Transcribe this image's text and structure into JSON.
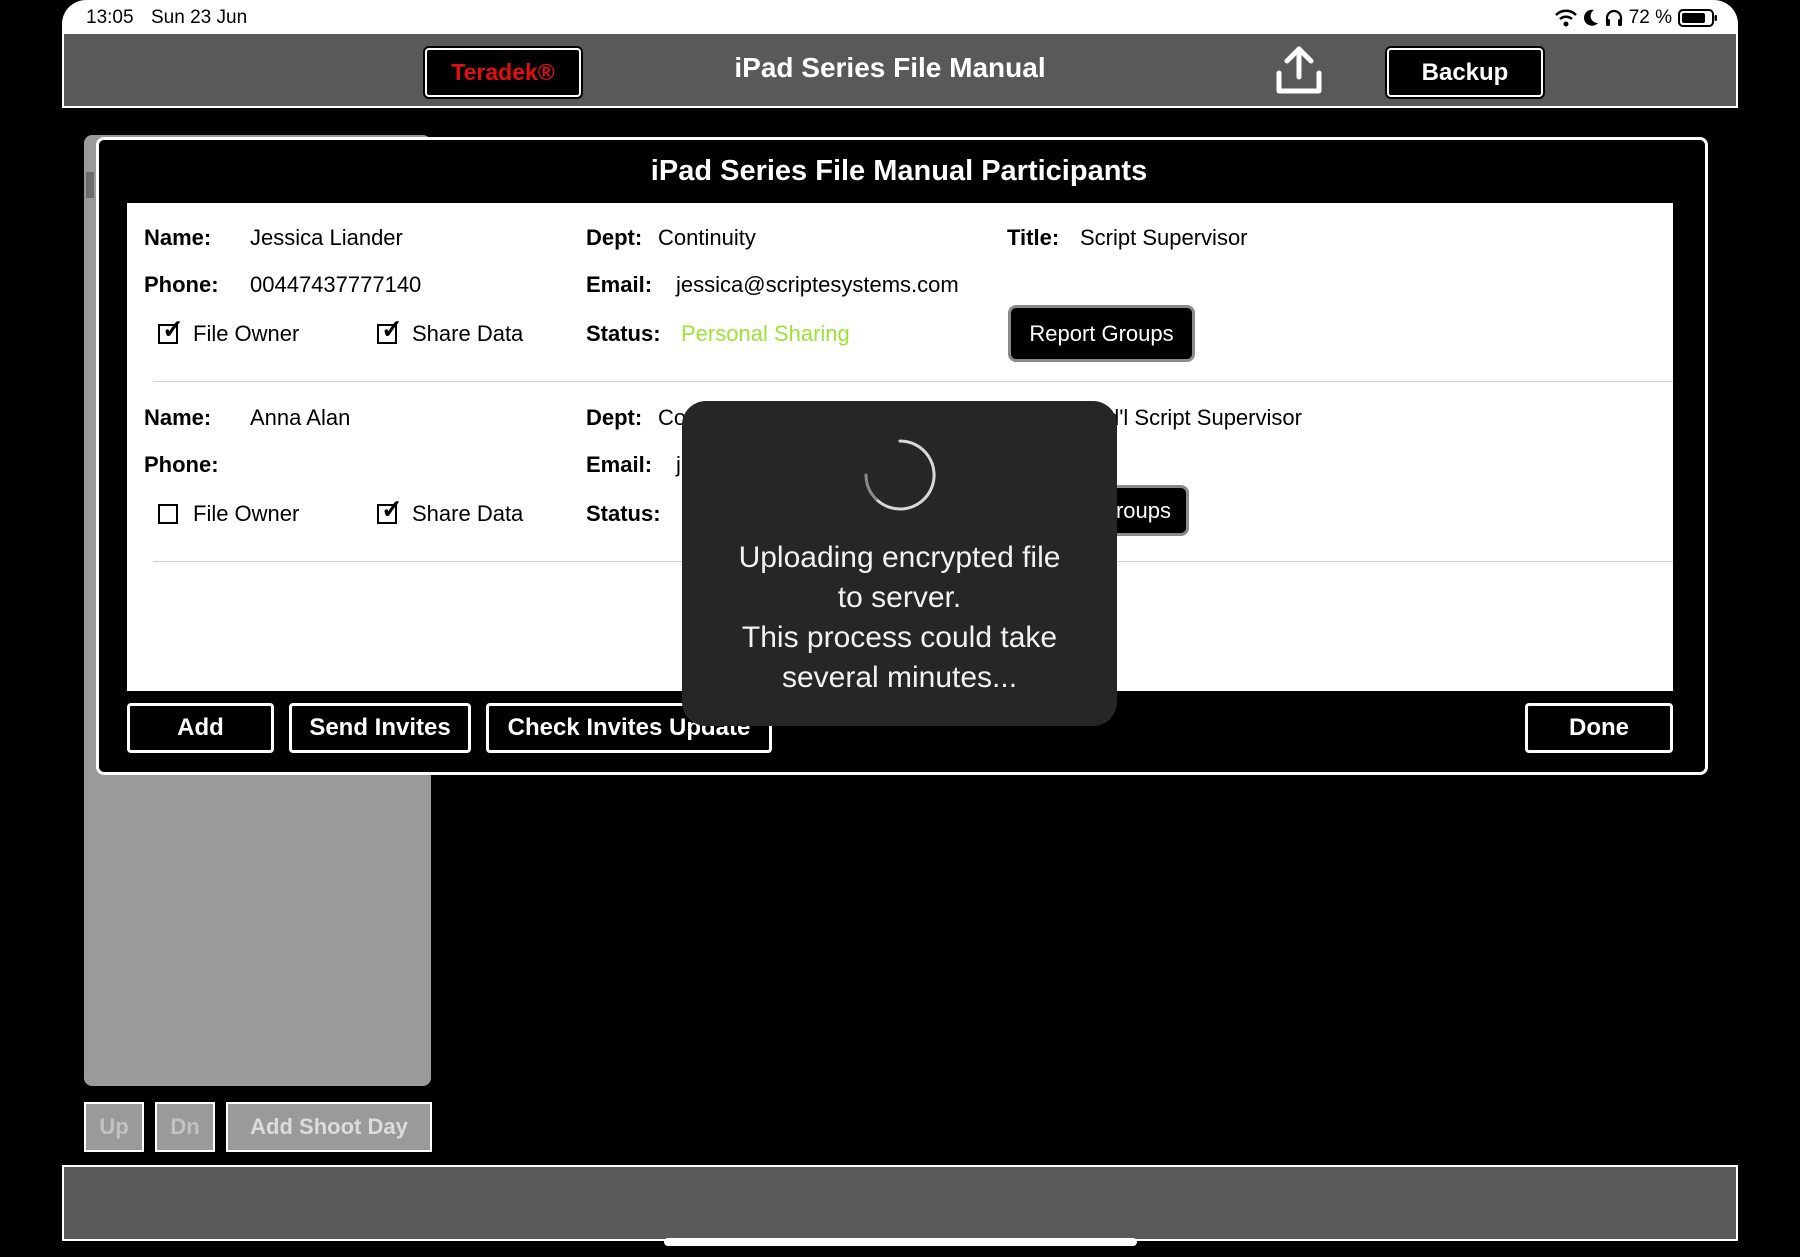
{
  "status_bar": {
    "time": "13:05",
    "date": "Sun 23 Jun",
    "battery": "72 %"
  },
  "header": {
    "brand_button": "Teradek®",
    "title": "iPad Series File Manual",
    "backup_button": "Backup"
  },
  "sidebar": {
    "up_button": "Up",
    "dn_button": "Dn",
    "add_shoot_day_button": "Add Shoot Day"
  },
  "modal": {
    "title": "iPad Series File Manual Participants",
    "labels": {
      "name": "Name:",
      "dept": "Dept:",
      "title": "Title:",
      "phone": "Phone:",
      "email": "Email:",
      "status": "Status:",
      "file_owner": "File Owner",
      "share_data": "Share Data",
      "report_groups": "Report Groups"
    },
    "participants": [
      {
        "name": "Jessica Liander",
        "dept": "Continuity",
        "title": "Script Supervisor",
        "phone": "00447437777140",
        "email": "jessica@scriptesystems.com",
        "status": "Personal Sharing",
        "status_color": "#9be336",
        "file_owner": true,
        "share_data": true
      },
      {
        "name": "Anna Alan",
        "dept": "Co",
        "title": "d'l Script Supervisor",
        "phone": "",
        "email": "j",
        "status": "",
        "file_owner": false,
        "share_data": true,
        "report_groups_partial": "roups"
      }
    ],
    "buttons": {
      "add": "Add",
      "send_invites": "Send Invites",
      "check_invites": "Check Invites Update",
      "done": "Done"
    }
  },
  "hud": {
    "line1": "Uploading encrypted file",
    "line2": "to server.",
    "line3": "This process could take",
    "line4": "several minutes..."
  },
  "icons": {
    "upload": "upload-icon",
    "wifi": "wifi-icon",
    "moon": "moon-icon",
    "headphones": "headphones-icon",
    "battery": "battery-icon",
    "spinner": "spinner-icon"
  },
  "colors": {
    "brand": "#e01010",
    "header_bg": "#595959",
    "status_green": "#9be336"
  }
}
